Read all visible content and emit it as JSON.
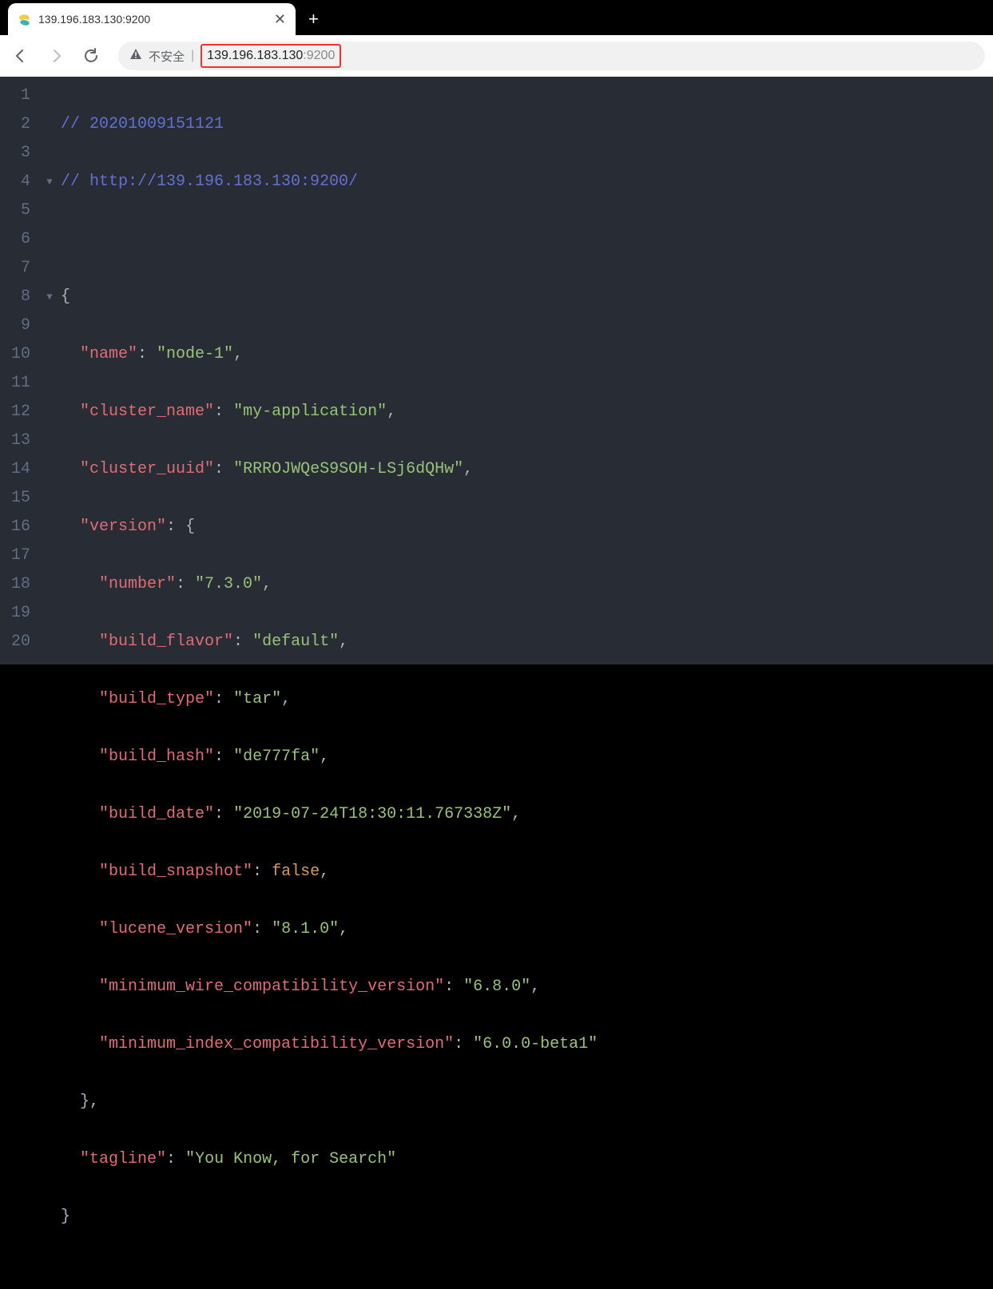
{
  "tab": {
    "title": "139.196.183.130:9200",
    "close_glyph": "✕",
    "new_tab_glyph": "+"
  },
  "toolbar": {
    "insecure_label": "不安全",
    "separator": "|",
    "url_host": "139.196.183.130",
    "url_port": ":9200"
  },
  "code": {
    "comment1": "// 20201009151121",
    "comment2": "// http://139.196.183.130:9200/",
    "k_open": "{",
    "k_close": "}",
    "k_close_comma": "},",
    "v_open": "{",
    "name_k": "\"name\"",
    "name_v": "\"node-1\"",
    "cluster_name_k": "\"cluster_name\"",
    "cluster_name_v": "\"my-application\"",
    "cluster_uuid_k": "\"cluster_uuid\"",
    "cluster_uuid_v": "\"RRROJWQeS9SOH-LSj6dQHw\"",
    "version_k": "\"version\"",
    "number_k": "\"number\"",
    "number_v": "\"7.3.0\"",
    "build_flavor_k": "\"build_flavor\"",
    "build_flavor_v": "\"default\"",
    "build_type_k": "\"build_type\"",
    "build_type_v": "\"tar\"",
    "build_hash_k": "\"build_hash\"",
    "build_hash_v": "\"de777fa\"",
    "build_date_k": "\"build_date\"",
    "build_date_v": "\"2019-07-24T18:30:11.767338Z\"",
    "build_snapshot_k": "\"build_snapshot\"",
    "build_snapshot_v": "false",
    "lucene_version_k": "\"lucene_version\"",
    "lucene_version_v": "\"8.1.0\"",
    "min_wire_k": "\"minimum_wire_compatibility_version\"",
    "min_wire_v": "\"6.8.0\"",
    "min_index_k": "\"minimum_index_compatibility_version\"",
    "min_index_v": "\"6.0.0-beta1\"",
    "tagline_k": "\"tagline\"",
    "tagline_v": "\"You Know, for Search\""
  },
  "line_numbers": [
    "1",
    "2",
    "3",
    "4",
    "5",
    "6",
    "7",
    "8",
    "9",
    "10",
    "11",
    "12",
    "13",
    "14",
    "15",
    "16",
    "17",
    "18",
    "19",
    "20"
  ],
  "fold_markers": {
    "4": "▼",
    "8": "▼"
  }
}
